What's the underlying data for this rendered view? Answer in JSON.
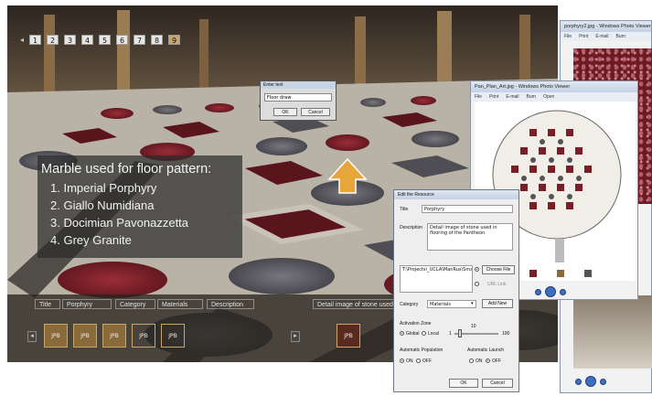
{
  "viewer": {
    "pages": [
      {
        "label": "1"
      },
      {
        "label": "2"
      },
      {
        "label": "3"
      },
      {
        "label": "4"
      },
      {
        "label": "5"
      },
      {
        "label": "6"
      },
      {
        "label": "7"
      },
      {
        "label": "8"
      },
      {
        "label": "9"
      }
    ],
    "active_page": "9"
  },
  "marble": {
    "title": "Marble used for floor pattern:",
    "items": [
      "1. Imperial Porphyry",
      "2. Giallo Numidiana",
      "3. Docimian Pavonazzetta",
      "4. Grey Granite"
    ]
  },
  "bottom_bar": {
    "title_label": "Title",
    "title_value": "Porphyry",
    "category_label": "Category",
    "category_value": "Materials",
    "description_label": "Description",
    "description_value": "Detail image of stone used in flo",
    "thumbnails": [
      "JPB",
      "JPB",
      "JPB",
      "JPB",
      "JPB"
    ],
    "right_thumb": "JPB"
  },
  "enter_text": {
    "title": "Enter text",
    "value": "Floor draw",
    "ok": "OK",
    "cancel": "Cancel"
  },
  "photo_viewer_1": {
    "title": "porphyry2.jpg - Windows Photo Viewer",
    "menu": [
      "File",
      "Print",
      "E-mail",
      "Burn"
    ]
  },
  "photo_viewer_2": {
    "title": "Pan_Plan_Art.jpg - Windows Photo Viewer",
    "menu": [
      "File",
      "Print",
      "E-mail",
      "Burn",
      "Open"
    ]
  },
  "edit_resource": {
    "title": "Edit the Resource",
    "title_label": "Title",
    "title_value": "Porphyry",
    "description_label": "Description",
    "description_value": "Detail image of stone used in flooring of the Pantheon",
    "paths": "T:\\Projects\\_UCLA\\ManRus\\SmallerBoard\\ModelTrees\\PantheonEmbeds",
    "choose_file": "Choose File",
    "url_link": "URL Link",
    "category_label": "Category",
    "category_value": "Materials",
    "add_new": "Add New",
    "activation_zone": "Activation Zone",
    "global": "Global",
    "local": "Local",
    "slider_min": "1",
    "slider_value": "10",
    "slider_max": "100",
    "auto_population": "Automatic Population",
    "auto_launch": "Automatic Launch",
    "on": "ON",
    "off": "OFF",
    "ok": "OK",
    "cancel": "Cancel"
  },
  "colors": {
    "porphyry": "#7a1f28",
    "granite": "#55555a",
    "marble_light": "#c7c1b8",
    "accent_gold": "#e7a63a"
  }
}
